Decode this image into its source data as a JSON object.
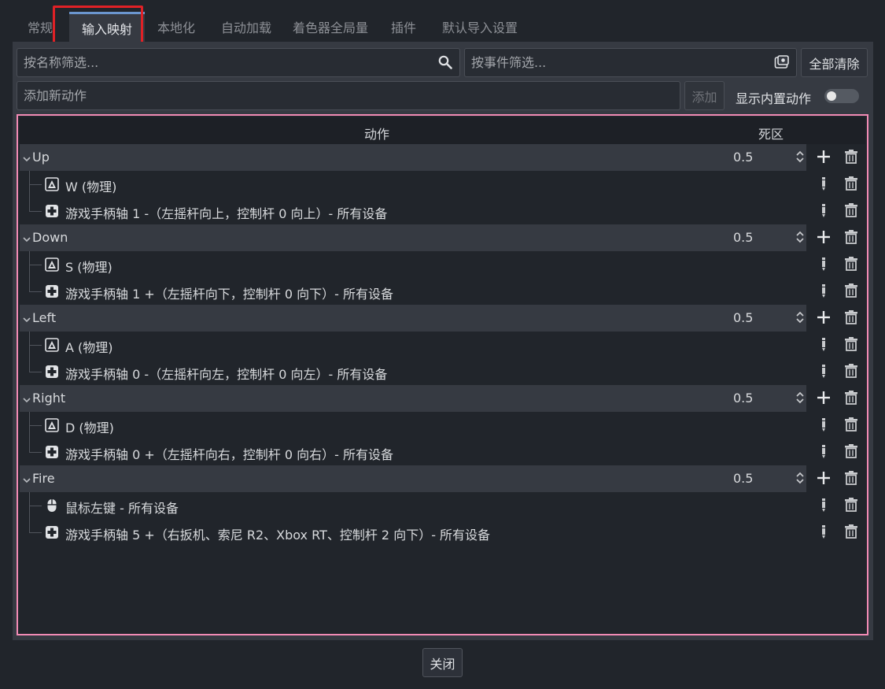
{
  "tabs": [
    {
      "label": "常规"
    },
    {
      "label": "输入映射"
    },
    {
      "label": "本地化"
    },
    {
      "label": "自动加载"
    },
    {
      "label": "着色器全局量"
    },
    {
      "label": "插件"
    },
    {
      "label": "默认导入设置"
    }
  ],
  "filters": {
    "name_placeholder": "按名称筛选...",
    "event_placeholder": "按事件筛选...",
    "clear_all": "全部清除"
  },
  "add_action": {
    "placeholder": "添加新动作",
    "add_button": "添加",
    "show_builtin": "显示内置动作",
    "show_builtin_on": false
  },
  "tree": {
    "col_action": "动作",
    "col_deadzone": "死区",
    "actions": [
      {
        "name": "Up",
        "deadzone": "0.5",
        "events": [
          {
            "type": "keyboard",
            "label": "W (物理)"
          },
          {
            "type": "joypad",
            "label": "游戏手柄轴 1 -（左摇杆向上，控制杆 0 向上）- 所有设备"
          }
        ]
      },
      {
        "name": "Down",
        "deadzone": "0.5",
        "events": [
          {
            "type": "keyboard",
            "label": "S (物理)"
          },
          {
            "type": "joypad",
            "label": "游戏手柄轴 1 +（左摇杆向下，控制杆 0 向下）- 所有设备"
          }
        ]
      },
      {
        "name": "Left",
        "deadzone": "0.5",
        "events": [
          {
            "type": "keyboard",
            "label": "A (物理)"
          },
          {
            "type": "joypad",
            "label": "游戏手柄轴 0 -（左摇杆向左，控制杆 0 向左）- 所有设备"
          }
        ]
      },
      {
        "name": "Right",
        "deadzone": "0.5",
        "events": [
          {
            "type": "keyboard",
            "label": "D (物理)"
          },
          {
            "type": "joypad",
            "label": "游戏手柄轴 0 +（左摇杆向右，控制杆 0 向右）- 所有设备"
          }
        ]
      },
      {
        "name": "Fire",
        "deadzone": "0.5",
        "events": [
          {
            "type": "mouse",
            "label": "鼠标左键 - 所有设备"
          },
          {
            "type": "joypad",
            "label": "游戏手柄轴 5 +（右扳机、索尼 R2、Xbox RT、控制杆 2 向下）- 所有设备"
          }
        ]
      }
    ]
  },
  "footer": {
    "close": "关闭"
  },
  "colors": {
    "accent": "#6b96cf",
    "tree_border": "#f28bb5",
    "highlight": "#e02126"
  }
}
